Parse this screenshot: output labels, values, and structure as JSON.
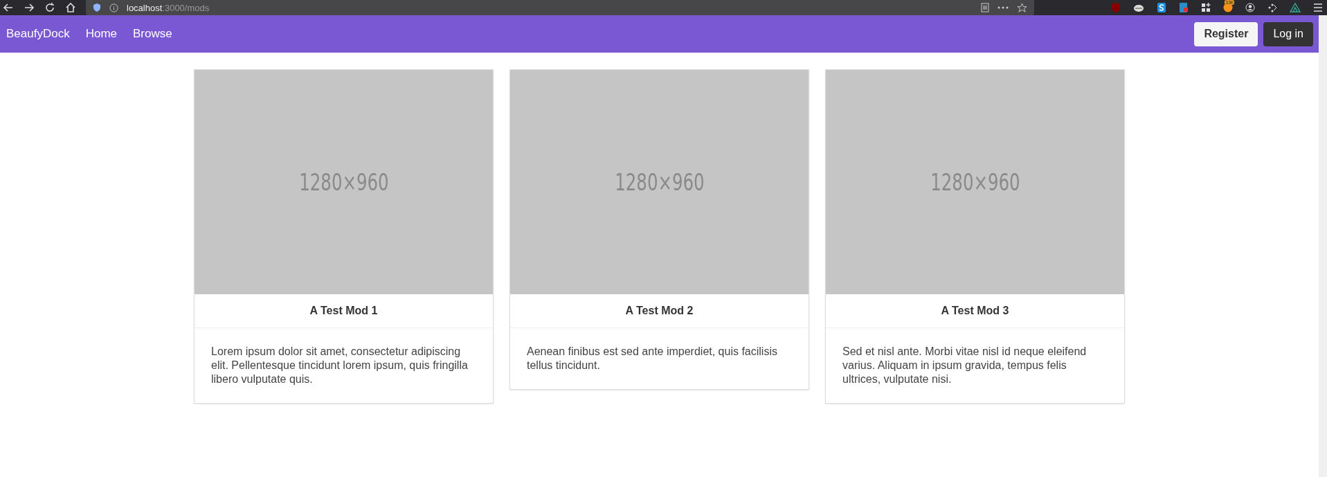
{
  "browser": {
    "url_host": "localhost",
    "url_path": ":3000/mods",
    "badge": "33K"
  },
  "navbar": {
    "brand": "BeaufyDock",
    "links": [
      "Home",
      "Browse"
    ],
    "buttons": [
      {
        "label": "Register",
        "kind": "light"
      },
      {
        "label": "Log in",
        "kind": "dark"
      }
    ]
  },
  "cards": [
    {
      "image_label": "1280×960",
      "title": "A Test Mod 1",
      "text": "Lorem ipsum dolor sit amet, consectetur adipiscing elit. Pellentesque tincidunt lorem ipsum, quis fringilla libero vulputate quis."
    },
    {
      "image_label": "1280×960",
      "title": "A Test Mod 2",
      "text": "Aenean finibus est sed ante imperdiet, quis facilisis tellus tincidunt."
    },
    {
      "image_label": "1280×960",
      "title": "A Test Mod 3",
      "text": "Sed et nisl ante. Morbi vitae nisl id neque eleifend varius. Aliquam in ipsum gravida, tempus felis ultrices, vulputate nisi."
    }
  ]
}
